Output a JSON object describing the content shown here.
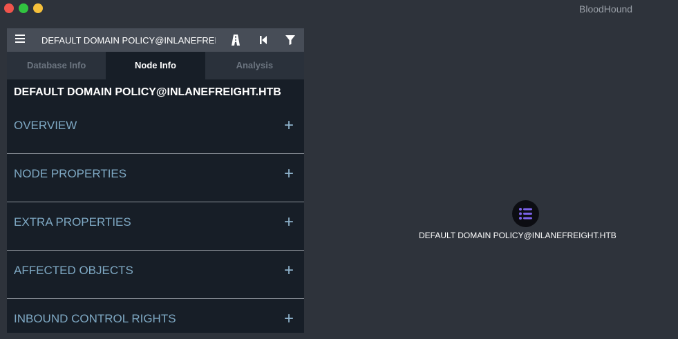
{
  "app": {
    "title": "BloodHound"
  },
  "search": {
    "value": "DEFAULT DOMAIN POLICY@INLANEFREIGHT.HTB"
  },
  "toolbar": {
    "menu_icon": "hamburger-menu-icon",
    "pathfinding_icon": "road-icon",
    "back_icon": "step-back-icon",
    "filter_icon": "filter-icon"
  },
  "tabs": [
    {
      "label": "Database Info"
    },
    {
      "label": "Node Info"
    },
    {
      "label": "Analysis"
    }
  ],
  "active_tab": "Node Info",
  "node_info": {
    "title": "DEFAULT DOMAIN POLICY@INLANEFREIGHT.HTB",
    "sections": [
      {
        "label": "OVERVIEW",
        "icon": "+"
      },
      {
        "label": "NODE PROPERTIES",
        "icon": "+"
      },
      {
        "label": "EXTRA PROPERTIES",
        "icon": "+"
      },
      {
        "label": "AFFECTED OBJECTS",
        "icon": "+"
      },
      {
        "label": "INBOUND CONTROL RIGHTS",
        "icon": "+"
      }
    ]
  },
  "graph": {
    "node_label": "DEFAULT DOMAIN POLICY@INLANEFREIGHT.HTB",
    "node_icon": "gpo-list-icon"
  },
  "colors": {
    "background": "#2e333b",
    "panel": "#171e27",
    "section_text": "#7fa9c4",
    "node_icon_accent": "#7b62e8"
  }
}
